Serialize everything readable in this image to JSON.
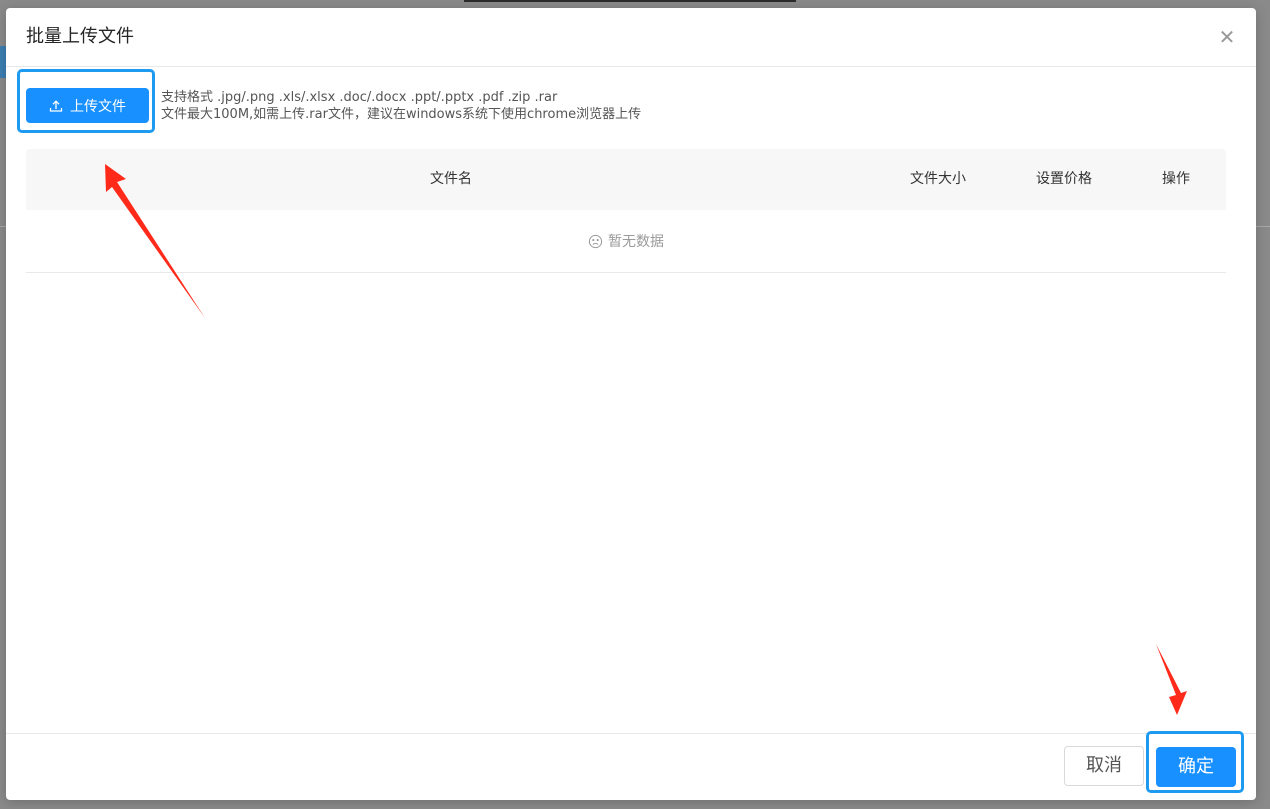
{
  "dialog": {
    "title": "批量上传文件",
    "close_icon": "close-icon",
    "close_glyph": "✕"
  },
  "upload": {
    "button_label": "上传文件",
    "icon": "upload-icon",
    "hint_formats": "支持格式 .jpg/.png .xls/.xlsx .doc/.docx .ppt/.pptx .pdf .zip .rar",
    "hint_limit": "文件最大100M,如需上传.rar文件，建议在windows系统下使用chrome浏览器上传"
  },
  "table": {
    "columns": [
      "文件名",
      "文件大小",
      "设置价格",
      "操作"
    ],
    "empty_text": "暂无数据",
    "empty_icon": "frown-icon"
  },
  "footer": {
    "cancel_label": "取消",
    "confirm_label": "确定"
  },
  "colors": {
    "primary": "#1890ff",
    "highlight_box": "#1e9bf0",
    "annotation_arrow": "#ff2a1a"
  }
}
